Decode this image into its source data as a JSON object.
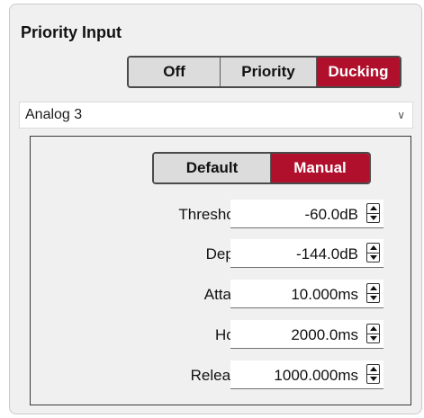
{
  "section": {
    "title": "Priority Input"
  },
  "mode_selector": {
    "options": [
      "Off",
      "Priority",
      "Ducking"
    ],
    "selected": "Ducking"
  },
  "input_select": {
    "value": "Analog 3"
  },
  "ducking": {
    "setting_selector": {
      "options": [
        "Default",
        "Manual"
      ],
      "selected": "Manual"
    },
    "params": [
      {
        "label": "Threshold",
        "value": "-60.0dB"
      },
      {
        "label": "Depth",
        "value": "-144.0dB"
      },
      {
        "label": "Attack",
        "value": "10.000ms"
      },
      {
        "label": "Hold",
        "value": "2000.0ms"
      },
      {
        "label": "Release",
        "value": "1000.000ms"
      }
    ]
  },
  "icons": {
    "dropdown": "chevron-down-icon",
    "spinner": "spinner-arrows-icon"
  },
  "colors": {
    "active": "#b0102c",
    "inactive": "#dcdcdc",
    "panel_bg": "#f0f0f0"
  }
}
